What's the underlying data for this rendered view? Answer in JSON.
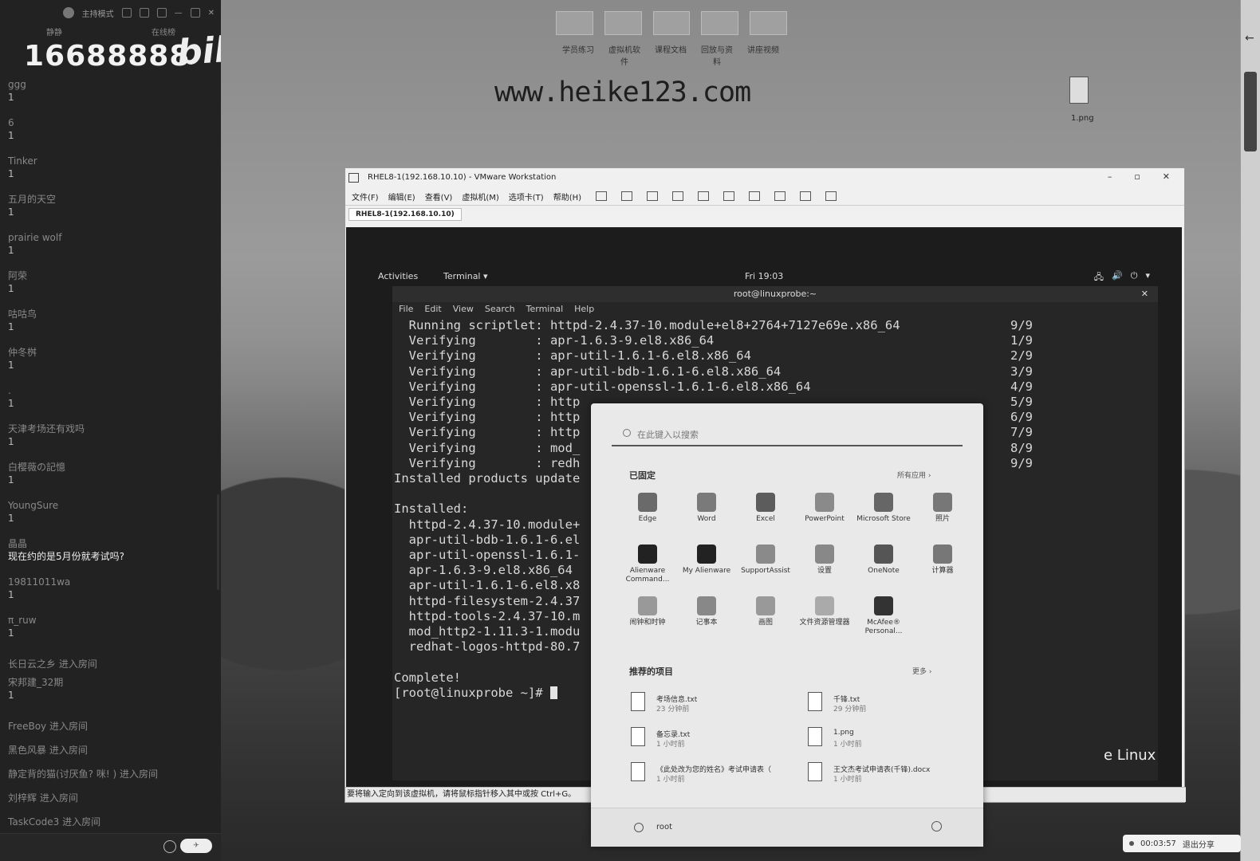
{
  "chat_panel": {
    "mode_label": "主持模式",
    "tabs": [
      "静静",
      "在线榜"
    ],
    "room_id": "16688888",
    "brand": "bilibili",
    "messages": [
      {
        "user": "ggg",
        "text": "1"
      },
      {
        "user": "6",
        "text": "1"
      },
      {
        "user": "Tinker",
        "text": "1"
      },
      {
        "user": "五月的天空",
        "text": "1"
      },
      {
        "user": "prairie wolf",
        "text": "1"
      },
      {
        "user": "阿荣",
        "text": "1"
      },
      {
        "user": "咕咕鸟",
        "text": "1"
      },
      {
        "user": "仲冬桝",
        "text": "1"
      },
      {
        "user": ".",
        "text": "1"
      },
      {
        "user": "天津考场还有戏吗",
        "text": "1"
      },
      {
        "user": "白樱薇の記憶",
        "text": "1"
      },
      {
        "user": "YoungSure",
        "text": "1"
      },
      {
        "user": "晶晶",
        "text": "现在约的是5月份就考试吗?"
      },
      {
        "user": "19811011wa",
        "text": "1"
      },
      {
        "user": "π_ruw",
        "text": "1"
      }
    ],
    "enter_events_a": [
      "长日云之乡 进入房间"
    ],
    "msg_after": {
      "user": "宋邦建_32期",
      "text": "1"
    },
    "enter_events_b": [
      "FreeBoy 进入房间",
      "黑色风暴 进入房间",
      "静定背的猫(讨厌鱼? 咪! ) 进入房间",
      "刘梓辉 进入房间",
      "TaskCode3 进入房间"
    ]
  },
  "desktop": {
    "url_text": "www.heike123.com",
    "file_icon_label": "1.png",
    "icon_labels": [
      "学员练习",
      "虚拟机软件",
      "课程文档",
      "回放与资料",
      "讲座视频"
    ]
  },
  "vmware": {
    "title": "RHEL8-1(192.168.10.10) - VMware Workstation",
    "menus": [
      "文件(F)",
      "编辑(E)",
      "查看(V)",
      "虚拟机(M)",
      "选项卡(T)",
      "帮助(H)"
    ],
    "tab": "RHEL8-1(192.168.10.10)",
    "status": "要将输入定向到该虚拟机，请将鼠标指针移入其中或按 Ctrl+G。"
  },
  "gnome": {
    "activities": "Activities",
    "app_menu": "Terminal ▾",
    "clock": "Fri 19:03",
    "tray": [
      "🖧",
      "🔊",
      "⏻",
      "▾"
    ],
    "brand_tail": "e Linux"
  },
  "terminal": {
    "title": "root@linuxprobe:~",
    "menus": [
      "File",
      "Edit",
      "View",
      "Search",
      "Terminal",
      "Help"
    ],
    "lines": [
      "  Running scriptlet: httpd-2.4.37-10.module+el8+2764+7127e69e.x86_64",
      "  Verifying        : apr-1.6.3-9.el8.x86_64",
      "  Verifying        : apr-util-1.6.1-6.el8.x86_64",
      "  Verifying        : apr-util-bdb-1.6.1-6.el8.x86_64",
      "  Verifying        : apr-util-openssl-1.6.1-6.el8.x86_64",
      "  Verifying        : http",
      "  Verifying        : http",
      "  Verifying        : http",
      "  Verifying        : mod_",
      "  Verifying        : redh",
      "Installed products update",
      "",
      "Installed:",
      "  httpd-2.4.37-10.module+",
      "  apr-util-bdb-1.6.1-6.el",
      "  apr-util-openssl-1.6.1-",
      "  apr-1.6.3-9.el8.x86_64",
      "  apr-util-1.6.1-6.el8.x8",
      "  httpd-filesystem-2.4.37",
      "  httpd-tools-2.4.37-10.m",
      "  mod_http2-1.11.3-1.modu",
      "  redhat-logos-httpd-80.7",
      "",
      "Complete!"
    ],
    "prompt": "[root@linuxprobe ~]# ",
    "counters": [
      "9/9",
      "1/9",
      "2/9",
      "3/9",
      "4/9",
      "5/9",
      "6/9",
      "7/9",
      "8/9",
      "9/9"
    ]
  },
  "start_menu": {
    "search_placeholder": "在此键入以搜索",
    "pinned_title": "已固定",
    "all_apps": "所有应用 ›",
    "apps": [
      {
        "label": "Edge",
        "color": "#6a6a6a"
      },
      {
        "label": "Word",
        "color": "#7a7a7a"
      },
      {
        "label": "Excel",
        "color": "#5c5c5c"
      },
      {
        "label": "PowerPoint",
        "color": "#8a8a8a"
      },
      {
        "label": "Microsoft Store",
        "color": "#666666"
      },
      {
        "label": "照片",
        "color": "#777777"
      },
      {
        "label": "Alienware Command...",
        "color": "#222222"
      },
      {
        "label": "My Alienware",
        "color": "#222222"
      },
      {
        "label": "SupportAssist",
        "color": "#8a8a8a"
      },
      {
        "label": "设置",
        "color": "#888888"
      },
      {
        "label": "OneNote",
        "color": "#555555"
      },
      {
        "label": "计算器",
        "color": "#777777"
      },
      {
        "label": "闹钟和时钟",
        "color": "#999999"
      },
      {
        "label": "记事本",
        "color": "#888888"
      },
      {
        "label": "画图",
        "color": "#999999"
      },
      {
        "label": "文件资源管理器",
        "color": "#aaaaaa"
      },
      {
        "label": "McAfee® Personal...",
        "color": "#333333"
      }
    ],
    "recommended_title": "推荐的项目",
    "more": "更多 ›",
    "recommended": [
      {
        "name": "考场信息.txt",
        "time": "23 分钟前"
      },
      {
        "name": "千锋.txt",
        "time": "29 分钟前"
      },
      {
        "name": "备忘录.txt",
        "time": "1 小时前"
      },
      {
        "name": "1.png",
        "time": "1 小时前"
      },
      {
        "name": "《此处改为您的姓名》考试申请表（",
        "time": "1 小时前"
      },
      {
        "name": "王文杰考试申请表(千锋).docx",
        "time": "1 小时前"
      }
    ],
    "user": "root"
  },
  "share_bar": {
    "timer": "00:03:57",
    "exit_label": "退出分享"
  }
}
